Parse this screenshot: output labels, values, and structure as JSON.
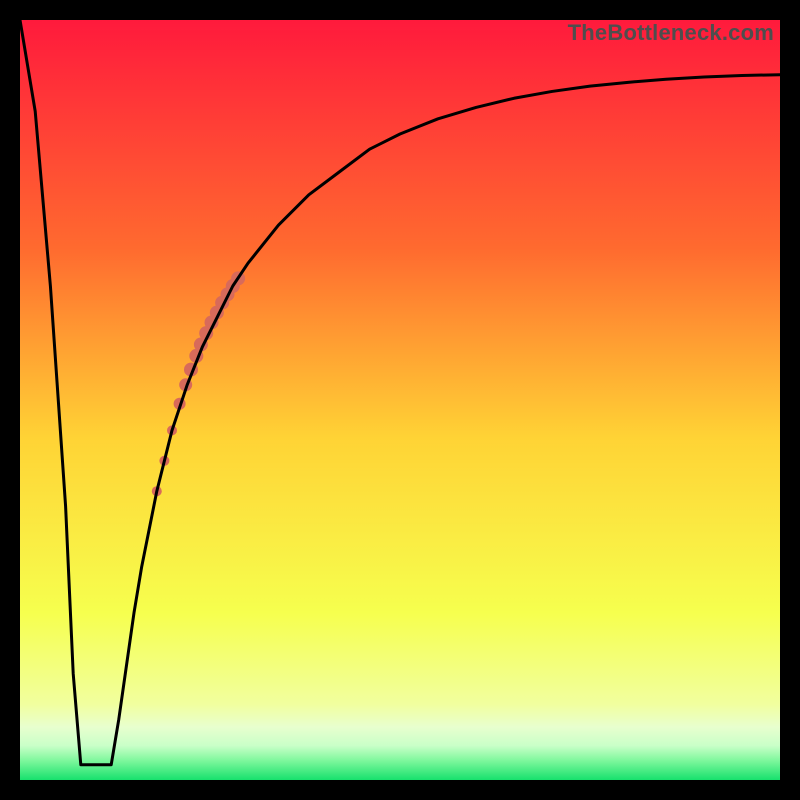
{
  "watermark": "TheBottleneck.com",
  "chart_data": {
    "type": "line",
    "title": "",
    "xlabel": "",
    "ylabel": "",
    "xlim": [
      0,
      100
    ],
    "ylim": [
      0,
      100
    ],
    "grid": false,
    "gradient_stops": [
      {
        "t": 0.0,
        "color": "#ff1a3c"
      },
      {
        "t": 0.3,
        "color": "#ff6a2f"
      },
      {
        "t": 0.55,
        "color": "#ffd335"
      },
      {
        "t": 0.78,
        "color": "#f6ff4e"
      },
      {
        "t": 0.9,
        "color": "#f1ff9e"
      },
      {
        "t": 0.93,
        "color": "#e8ffce"
      },
      {
        "t": 0.955,
        "color": "#c9ffc8"
      },
      {
        "t": 0.975,
        "color": "#7cf79b"
      },
      {
        "t": 1.0,
        "color": "#17e16d"
      }
    ],
    "series": [
      {
        "name": "bottleneck-curve",
        "color": "#000000",
        "x": [
          0,
          2,
          4,
          6,
          7,
          8,
          9,
          10,
          11,
          12,
          13,
          14,
          15,
          16,
          18,
          20,
          22,
          24,
          26,
          28,
          30,
          34,
          38,
          42,
          46,
          50,
          55,
          60,
          65,
          70,
          75,
          80,
          85,
          90,
          95,
          100
        ],
        "y": [
          100,
          88,
          65,
          36,
          14,
          2,
          2,
          2,
          2,
          2,
          8,
          15,
          22,
          28,
          38,
          46,
          52,
          57,
          61,
          65,
          68,
          73,
          77,
          80,
          83,
          85,
          87,
          88.5,
          89.7,
          90.6,
          91.3,
          91.8,
          92.2,
          92.5,
          92.7,
          92.8
        ]
      }
    ],
    "markers": {
      "name": "highlight-band",
      "color": "#d86a5a",
      "points": [
        {
          "x": 18.0,
          "y": 38.0,
          "r": 5
        },
        {
          "x": 19.0,
          "y": 42.0,
          "r": 5
        },
        {
          "x": 20.0,
          "y": 46.0,
          "r": 5
        },
        {
          "x": 21.0,
          "y": 49.5,
          "r": 6
        },
        {
          "x": 21.8,
          "y": 52.0,
          "r": 6.5
        },
        {
          "x": 22.5,
          "y": 54.0,
          "r": 7
        },
        {
          "x": 23.2,
          "y": 55.8,
          "r": 7
        },
        {
          "x": 23.8,
          "y": 57.3,
          "r": 7
        },
        {
          "x": 24.5,
          "y": 58.8,
          "r": 7
        },
        {
          "x": 25.2,
          "y": 60.2,
          "r": 7
        },
        {
          "x": 25.9,
          "y": 61.5,
          "r": 7
        },
        {
          "x": 26.6,
          "y": 62.8,
          "r": 7
        },
        {
          "x": 27.3,
          "y": 63.9,
          "r": 7
        },
        {
          "x": 28.0,
          "y": 65.0,
          "r": 7
        },
        {
          "x": 28.7,
          "y": 66.0,
          "r": 7
        }
      ]
    }
  }
}
